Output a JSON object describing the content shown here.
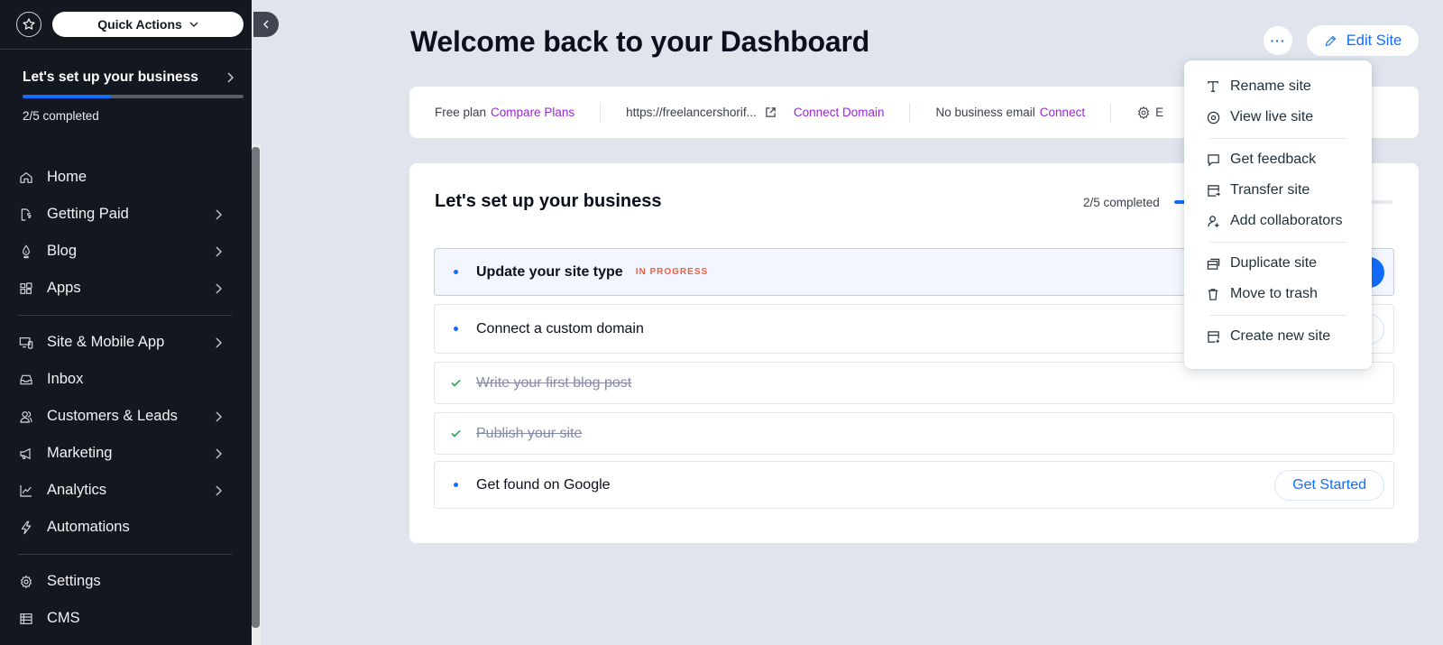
{
  "sidebar": {
    "quick_actions_label": "Quick Actions",
    "setup": {
      "title": "Let's set up your business",
      "progress": 0.4,
      "count_label": "2/5 completed"
    },
    "nav_groups": [
      [
        {
          "label": "Home",
          "icon": "home-icon",
          "has_chevron": false
        },
        {
          "label": "Getting Paid",
          "icon": "payment-icon",
          "has_chevron": true
        },
        {
          "label": "Blog",
          "icon": "pen-nib-icon",
          "has_chevron": true
        },
        {
          "label": "Apps",
          "icon": "apps-icon",
          "has_chevron": true
        }
      ],
      [
        {
          "label": "Site & Mobile App",
          "icon": "devices-icon",
          "has_chevron": true
        },
        {
          "label": "Inbox",
          "icon": "inbox-icon",
          "has_chevron": false
        },
        {
          "label": "Customers & Leads",
          "icon": "customers-icon",
          "has_chevron": true
        },
        {
          "label": "Marketing",
          "icon": "megaphone-icon",
          "has_chevron": true
        },
        {
          "label": "Analytics",
          "icon": "chart-icon",
          "has_chevron": true
        },
        {
          "label": "Automations",
          "icon": "lightning-icon",
          "has_chevron": false
        }
      ],
      [
        {
          "label": "Settings",
          "icon": "gear-icon",
          "has_chevron": false
        },
        {
          "label": "CMS",
          "icon": "table-icon",
          "has_chevron": false
        }
      ]
    ]
  },
  "header": {
    "title": "Welcome back to your Dashboard",
    "more_label": "···",
    "edit_site_label": "Edit Site"
  },
  "info_bar": {
    "plan_text": "Free plan",
    "plan_link": "Compare Plans",
    "url_text": "https://freelancershorif...",
    "domain_link": "Connect Domain",
    "email_text": "No business email",
    "email_link": "Connect",
    "settings_text": "E"
  },
  "setup_card": {
    "title": "Let's set up your business",
    "progress_label": "2/5 completed",
    "progress": 0.4,
    "tasks": [
      {
        "label": "Update your site type",
        "status": "active",
        "badge": "IN PROGRESS",
        "button": ""
      },
      {
        "label": "Connect a custom domain",
        "status": "todo",
        "badge": "",
        "button": ""
      },
      {
        "label": "Write your first blog post",
        "status": "done",
        "badge": "",
        "button": ""
      },
      {
        "label": "Publish your site",
        "status": "done",
        "badge": "",
        "button": ""
      },
      {
        "label": "Get found on Google",
        "status": "todo",
        "badge": "",
        "button": "Get Started"
      }
    ]
  },
  "menu": {
    "groups": [
      [
        {
          "label": "Rename site",
          "icon": "text-icon"
        },
        {
          "label": "View live site",
          "icon": "eye-icon"
        }
      ],
      [
        {
          "label": "Get feedback",
          "icon": "comment-icon"
        },
        {
          "label": "Transfer site",
          "icon": "transfer-icon"
        },
        {
          "label": "Add collaborators",
          "icon": "add-user-icon"
        }
      ],
      [
        {
          "label": "Duplicate site",
          "icon": "duplicate-icon"
        },
        {
          "label": "Move to trash",
          "icon": "trash-icon"
        }
      ],
      [
        {
          "label": "Create new site",
          "icon": "create-site-icon"
        }
      ]
    ]
  },
  "colors": {
    "sidebar_bg": "#131720",
    "accent_blue": "#116dff",
    "link_purple": "#9a27d5",
    "badge_orange": "#f25c3e",
    "done_green": "#25a55a",
    "page_bg": "#dfe4ed"
  }
}
